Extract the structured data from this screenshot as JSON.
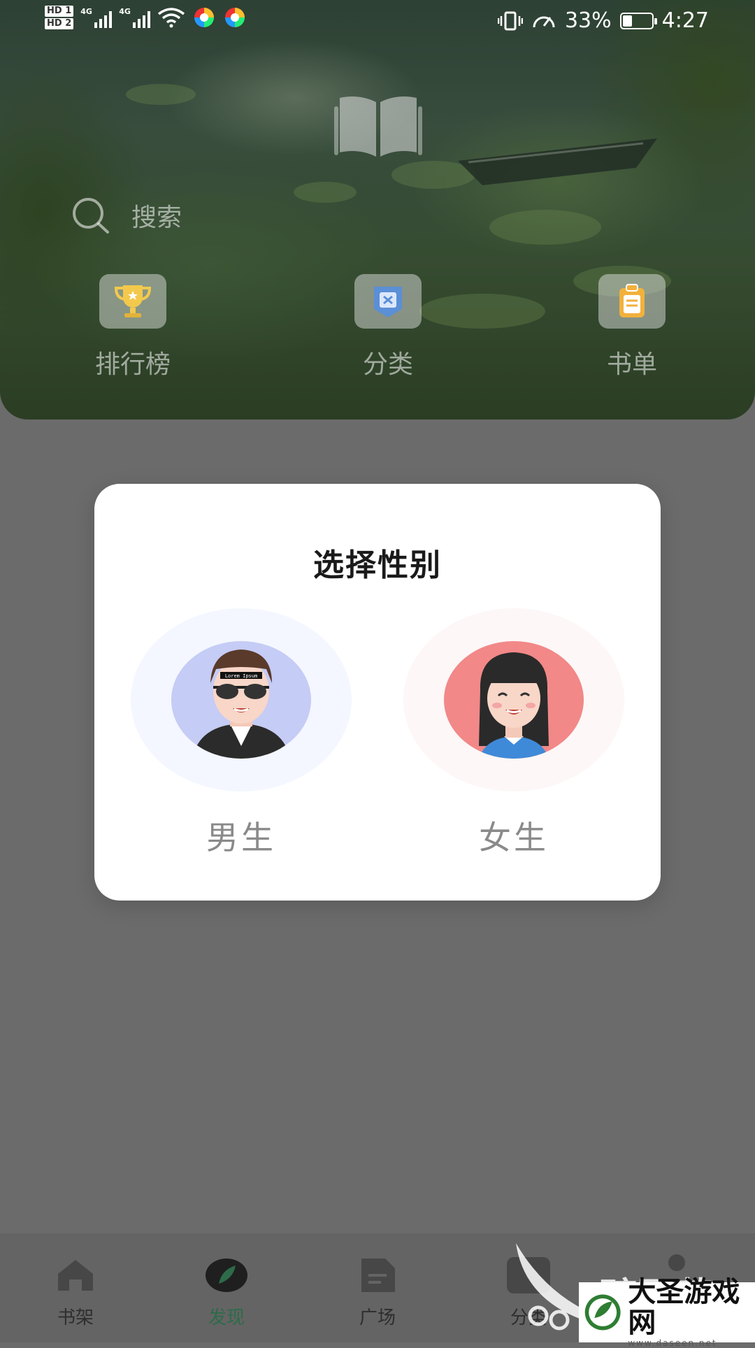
{
  "status_bar": {
    "sim1": "HD 1",
    "sim2": "HD 2",
    "network1": "4G",
    "network2": "4G",
    "battery_percent": "33%",
    "battery_level": 0.33,
    "time": "4:27"
  },
  "hero": {
    "search_label": "搜索",
    "quick_links": [
      {
        "label": "排行榜",
        "icon": "trophy-icon"
      },
      {
        "label": "分类",
        "icon": "category-icon"
      },
      {
        "label": "书单",
        "icon": "book-list-icon"
      }
    ]
  },
  "dialog": {
    "title": "选择性别",
    "options": [
      {
        "label": "男生",
        "avatar_text": "Lorem Ipsum"
      },
      {
        "label": "女生"
      }
    ]
  },
  "bottom_nav": {
    "items": [
      {
        "label": "书架",
        "icon": "home-icon"
      },
      {
        "label": "发现",
        "icon": "discover-icon"
      },
      {
        "label": "广场",
        "icon": "square-icon"
      },
      {
        "label": "分类",
        "icon": "category-icon"
      }
    ],
    "active_index": 1
  },
  "watermarks": {
    "pea_brand": "豌豆荚",
    "site_name": "大圣游戏网",
    "site_url": "www.daseen.net"
  },
  "colors": {
    "accent_green": "#2d6b4a",
    "dialog_bg": "#ffffff",
    "male_avatar_bg": "#c5ccf5",
    "female_avatar_bg": "#f28888"
  }
}
